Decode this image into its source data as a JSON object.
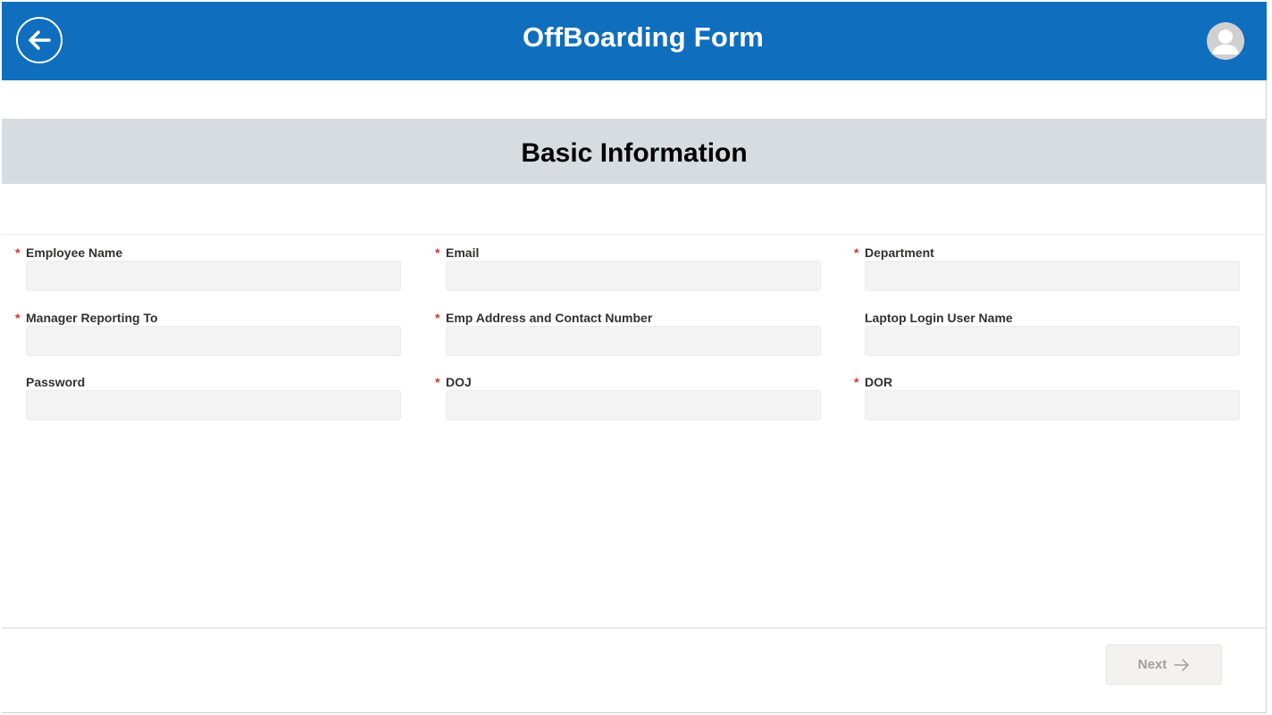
{
  "header": {
    "title": "OffBoarding Form",
    "back_icon": "arrow-left-circle-icon",
    "avatar_icon": "user-avatar-icon",
    "background_color": "#106ebe"
  },
  "section": {
    "title": "Basic Information",
    "band_color": "#d6dce0"
  },
  "fields": {
    "employee_name": {
      "label": "Employee Name",
      "required": true,
      "value": ""
    },
    "email": {
      "label": "Email",
      "required": true,
      "value": ""
    },
    "department": {
      "label": "Department",
      "required": true,
      "value": ""
    },
    "manager": {
      "label": "Manager Reporting To",
      "required": true,
      "value": ""
    },
    "address_contact": {
      "label": "Emp Address and Contact Number",
      "required": true,
      "value": ""
    },
    "laptop_user": {
      "label": "Laptop Login User Name",
      "required": false,
      "value": ""
    },
    "password": {
      "label": "Password",
      "required": false,
      "value": ""
    },
    "doj": {
      "label": "DOJ",
      "required": true,
      "value": ""
    },
    "dor": {
      "label": "DOR",
      "required": true,
      "value": ""
    }
  },
  "required_marker": "*",
  "required_color": "#d13438",
  "footer": {
    "next_label": "Next",
    "next_icon": "arrow-right-icon",
    "next_disabled": true
  }
}
